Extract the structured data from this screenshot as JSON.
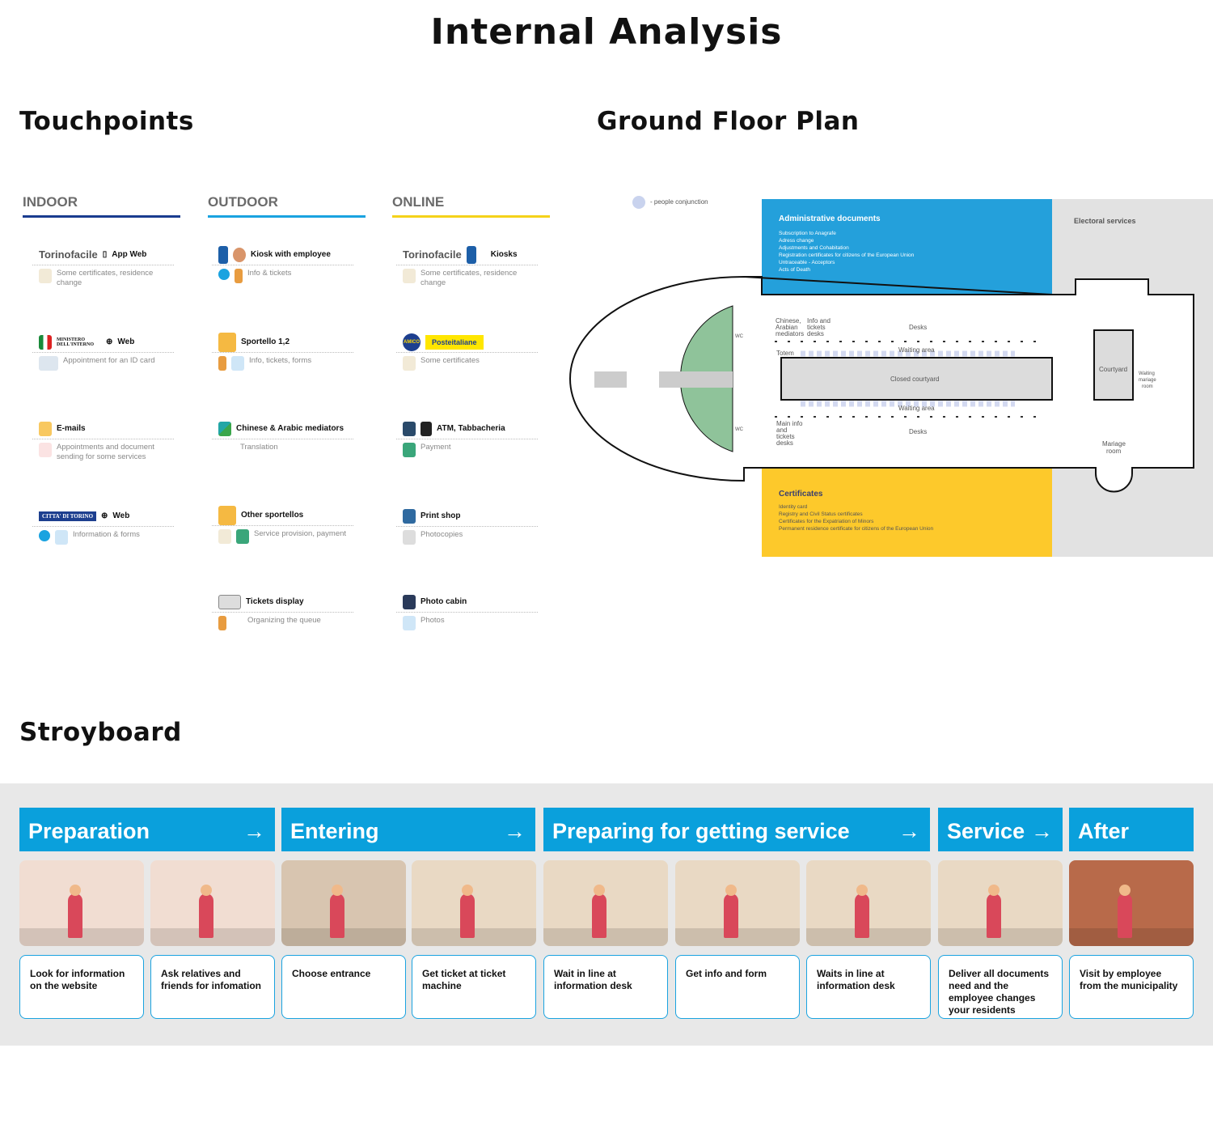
{
  "title": "Internal Analysis",
  "sections": {
    "touchpoints": "Touchpoints",
    "floor_plan": "Ground Floor Plan",
    "storyboard": "Stroyboard"
  },
  "colors": {
    "indoor": "#1a3c8f",
    "outdoor": "#1aa3e0",
    "online": "#f5d21a",
    "admin": "#24a0db",
    "certificates": "#fdc92b",
    "phase": "#0aa0dc"
  },
  "touchpoints": {
    "indoor": {
      "label": "INDOOR",
      "items": [
        {
          "logo": "Torinofacile",
          "channels": "App  Web",
          "desc": "Some certificates, residence change",
          "icons": [
            "torinofacile-logo",
            "phone-icon",
            "globe-icon",
            "certificate-icon"
          ]
        },
        {
          "logo": "MINISTERO DELL'INTERNO",
          "channels": "Web",
          "desc": "Appointment for an ID card",
          "icons": [
            "italy-flag-icon",
            "globe-icon",
            "id-card-icon"
          ]
        },
        {
          "logo": "",
          "channels": "E-mails",
          "desc": "Appointments and document sending for some services",
          "icons": [
            "email-icon",
            "calendar-icon"
          ]
        },
        {
          "logo": "CITTA' DI TORINO",
          "channels": "Web",
          "desc": "Information & forms",
          "icons": [
            "torino-crest-icon",
            "globe-icon",
            "info-icon",
            "form-icon"
          ]
        }
      ]
    },
    "outdoor": {
      "label": "OUTDOOR",
      "items": [
        {
          "title": "Kiosk with employee",
          "desc": "Info & tickets",
          "icons": [
            "kiosk-icon",
            "employee-icon",
            "info-icon",
            "ticket-icon"
          ]
        },
        {
          "title": "Sportello 1,2",
          "desc": "Info, tickets, forms",
          "icons": [
            "clerk-icon",
            "ticket-icon",
            "form-icon"
          ]
        },
        {
          "title": "Chinese & Arabic mediators",
          "desc": "Translation",
          "icons": [
            "translate-icon"
          ]
        },
        {
          "title": "Other sportellos",
          "desc": "Service provision, payment",
          "icons": [
            "clerk-icon",
            "certificate-icon",
            "money-icon"
          ]
        },
        {
          "title": "Tickets display",
          "desc": "Organizing the queue",
          "icons": [
            "display-icon",
            "ticket-icon"
          ]
        }
      ]
    },
    "online": {
      "label": "ONLINE",
      "items": [
        {
          "logo": "Torinofacile",
          "title": "Kiosks",
          "desc": "Some certificates, residence change",
          "icons": [
            "torinofacile-logo",
            "kiosk-icon",
            "certificate-icon"
          ]
        },
        {
          "logo": "AMICO",
          "title": "Posteitaliane",
          "desc": "Some certificates",
          "icons": [
            "amico-logo",
            "certificate-icon"
          ]
        },
        {
          "title": "ATM, Tabbacheria",
          "desc": "Payment",
          "icons": [
            "atm-icon",
            "tabacchi-icon",
            "money-icon"
          ]
        },
        {
          "title": "Print shop",
          "desc": "Photocopies",
          "icons": [
            "printer-icon",
            "copies-icon"
          ]
        },
        {
          "title": "Photo cabin",
          "desc": "Photos",
          "icons": [
            "camera-icon",
            "photo-icon"
          ]
        }
      ]
    }
  },
  "floor_plan": {
    "legend": "- people conjunction",
    "admin": {
      "title": "Administrative documents",
      "lines": [
        "Subscription to Anagrafe",
        "Adress change",
        "Adjustments and Cohabitation",
        "Registration certificates for citizens of the European Union",
        "Untraceable - Acceptors",
        "Acts of Death"
      ]
    },
    "electoral": "Electoral services",
    "certificates": {
      "title": "Certificates",
      "lines": [
        "Identity card",
        "Registry and Civil Status certificates",
        "Certificates for the Expatriation of Minors",
        "Permanent residence certificate for citizens of the European Union"
      ]
    },
    "labels": {
      "wc": "WC",
      "mediators": [
        "Chinese,",
        "Arabian",
        "mediators"
      ],
      "info_desks": [
        "Info and",
        "tickets",
        "desks"
      ],
      "desks": "Desks",
      "waiting": "Waiting area",
      "totem": "Totem",
      "closed_courtyard": "Closed courtyard",
      "courtyard": "Courtyard",
      "waiting_mariage": [
        "Waiting",
        "mariage",
        "room"
      ],
      "main_info": [
        "Main info",
        "and",
        "tickets",
        "desks"
      ],
      "mariage": [
        "Mariage",
        "room"
      ]
    }
  },
  "storyboard": {
    "phases": [
      {
        "label": "Preparation",
        "arrow": "→"
      },
      {
        "label": "Entering",
        "arrow": "→"
      },
      {
        "label": "Preparing for getting service",
        "arrow": "→"
      },
      {
        "label": "Service",
        "arrow": "→"
      },
      {
        "label": "After",
        "arrow": ""
      }
    ],
    "steps": [
      "Look for information on the website",
      "Ask relatives and friends for infomation",
      "Choose entrance",
      "Get ticket at ticket machine",
      "Wait in line at information desk",
      "Get info and form",
      "Waits in line at information desk",
      "Deliver all documents need and the employee changes your residents",
      "Visit by employee from the municipality"
    ]
  }
}
